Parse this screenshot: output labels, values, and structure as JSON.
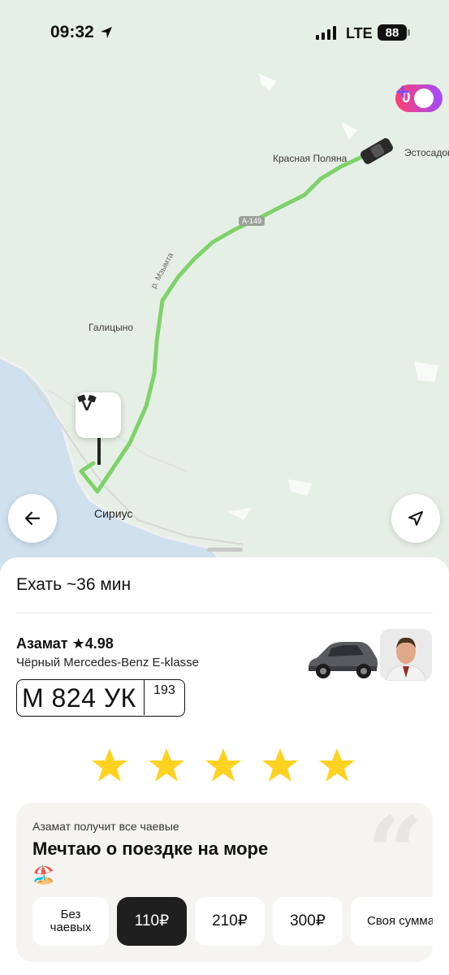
{
  "status_bar": {
    "time": "09:32",
    "network": "LTE",
    "battery": "88"
  },
  "map": {
    "labels": {
      "krasnaya_polyana": "Красная Поляна",
      "estosadok": "Эстосадок",
      "galitsyno": "Галицыно",
      "sirius": "Сириус"
    },
    "road_badge": "А-149",
    "river_label": "р. Мзымта",
    "plus_points": "0",
    "icons": {
      "finish": "finish-flags-icon",
      "car": "car-icon",
      "back": "arrow-left-icon",
      "locate": "navigation-arrow-icon"
    }
  },
  "trip": {
    "eta": "Ехать ~36 мин"
  },
  "driver": {
    "name": "Азамат",
    "rating_star": "★",
    "rating": "4.98",
    "car": "Чёрный Mercedes-Benz E-klasse",
    "plate_main": "М 824 УК",
    "plate_region": "193"
  },
  "rating_stars": 5,
  "tips": {
    "subtitle": "Азамат получит все чаевые",
    "title": "Мечтаю о поездке на море",
    "emoji": "🏖️",
    "quote_glyph": "“",
    "options": [
      {
        "label_line1": "Без",
        "label_line2": "чаевых"
      },
      {
        "label": "110₽",
        "selected": true
      },
      {
        "label": "210₽"
      },
      {
        "label": "300₽"
      },
      {
        "label": "Своя сумма"
      }
    ]
  },
  "colors": {
    "route": "#7ed26b",
    "star": "#ffd21f",
    "accent_dark": "#1f1f1f"
  }
}
